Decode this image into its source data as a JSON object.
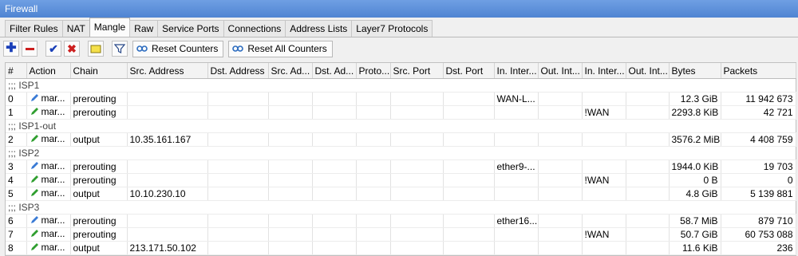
{
  "window": {
    "title": "Firewall"
  },
  "tabs": [
    "Filter Rules",
    "NAT",
    "Mangle",
    "Raw",
    "Service Ports",
    "Connections",
    "Address Lists",
    "Layer7 Protocols"
  ],
  "active_tab": "Mangle",
  "toolbar": {
    "reset_counters": "Reset Counters",
    "reset_all_counters": "Reset All Counters"
  },
  "columns": [
    "#",
    "Action",
    "Chain",
    "Src. Address",
    "Dst. Address",
    "Src. Ad...",
    "Dst. Ad...",
    "Proto...",
    "Src. Port",
    "Dst. Port",
    "In. Inter...",
    "Out. Int...",
    "In. Inter...",
    "Out. Int...",
    "Bytes",
    "Packets"
  ],
  "rows": [
    {
      "comment": ";;; ISP1"
    },
    {
      "num": "0",
      "action": "mar...",
      "icon": "blue",
      "chain": "prerouting",
      "src": "",
      "in_if": "WAN-L...",
      "in_if_list": "",
      "bytes": "12.3 GiB",
      "packets": "11 942 673"
    },
    {
      "num": "1",
      "action": "mar...",
      "icon": "green",
      "chain": "prerouting",
      "src": "",
      "in_if": "",
      "in_if_list": "!WAN",
      "bytes": "2293.8 KiB",
      "packets": "42 721"
    },
    {
      "comment": ";;; ISP1-out"
    },
    {
      "num": "2",
      "action": "mar...",
      "icon": "green",
      "chain": "output",
      "src": "10.35.161.167",
      "in_if": "",
      "in_if_list": "",
      "bytes": "3576.2 MiB",
      "packets": "4 408 759"
    },
    {
      "comment": ";;; ISP2"
    },
    {
      "num": "3",
      "action": "mar...",
      "icon": "blue",
      "chain": "prerouting",
      "src": "",
      "in_if": "ether9-...",
      "in_if_list": "",
      "bytes": "1944.0 KiB",
      "packets": "19 703"
    },
    {
      "num": "4",
      "action": "mar...",
      "icon": "green",
      "chain": "prerouting",
      "src": "",
      "in_if": "",
      "in_if_list": "!WAN",
      "bytes": "0 B",
      "packets": "0"
    },
    {
      "num": "5",
      "action": "mar...",
      "icon": "green",
      "chain": "output",
      "src": "10.10.230.10",
      "in_if": "",
      "in_if_list": "",
      "bytes": "4.8 GiB",
      "packets": "5 139 881"
    },
    {
      "comment": ";;; ISP3"
    },
    {
      "num": "6",
      "action": "mar...",
      "icon": "blue",
      "chain": "prerouting",
      "src": "",
      "in_if": "ether16...",
      "in_if_list": "",
      "bytes": "58.7 MiB",
      "packets": "879 710"
    },
    {
      "num": "7",
      "action": "mar...",
      "icon": "green",
      "chain": "prerouting",
      "src": "",
      "in_if": "",
      "in_if_list": "!WAN",
      "bytes": "50.7 GiB",
      "packets": "60 753 088"
    },
    {
      "num": "8",
      "action": "mar...",
      "icon": "green",
      "chain": "output",
      "src": "213.171.50.102",
      "in_if": "",
      "in_if_list": "",
      "bytes": "11.6 KiB",
      "packets": "236"
    }
  ],
  "colors": {
    "title_bar": "#4f84d2",
    "add": "#1a3fb8",
    "remove": "#cc1f1f",
    "enable": "#1a3fb8",
    "disable": "#cc1f1f",
    "comment": "#e8c400",
    "icon_blue": "#3a7bd5",
    "icon_green": "#2f9e2f"
  },
  "icons": {
    "add": "plus-icon",
    "remove": "minus-icon",
    "enable": "check-icon",
    "disable": "x-icon",
    "comment": "note-icon",
    "filter": "funnel-icon",
    "reset": "reset-icon",
    "action": "pencil-icon"
  }
}
